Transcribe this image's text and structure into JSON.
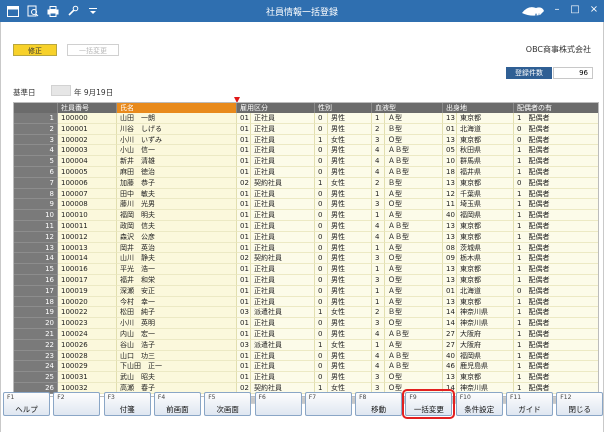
{
  "app": {
    "title": "社員情報一括登録",
    "company": "OBC商事株式会社"
  },
  "toolbar": {
    "icons": [
      "window-icon",
      "search-icon",
      "print-icon",
      "tools-icon",
      "dropdown-icon"
    ]
  },
  "mode": {
    "edit": "修正",
    "bulk": "一括変更"
  },
  "count": {
    "label": "登録件数",
    "value": "96"
  },
  "base_date": {
    "label": "基準日",
    "text": "年  9月19日"
  },
  "columns": [
    "社員番号",
    "氏名",
    "雇用区分",
    "",
    "性別",
    "",
    "血液型",
    "",
    "出身地",
    "",
    "配偶者の有"
  ],
  "rows": [
    {
      "n": "1",
      "id": "100000",
      "name": "山田　一朗",
      "ec": "01",
      "et": "正社員",
      "sc": "0",
      "st": "男性",
      "bc": "1",
      "bt": "Ａ型",
      "pc": "13",
      "pt": "東京都",
      "sp": "1　配偶者"
    },
    {
      "n": "2",
      "id": "100001",
      "name": "川谷　しげる",
      "ec": "01",
      "et": "正社員",
      "sc": "0",
      "st": "男性",
      "bc": "2",
      "bt": "Ｂ型",
      "pc": "01",
      "pt": "北海道",
      "sp": "0　配偶者"
    },
    {
      "n": "3",
      "id": "100002",
      "name": "小川　いずみ",
      "ec": "01",
      "et": "正社員",
      "sc": "1",
      "st": "女性",
      "bc": "3",
      "bt": "Ｏ型",
      "pc": "13",
      "pt": "東京都",
      "sp": "0　配偶者"
    },
    {
      "n": "4",
      "id": "100003",
      "name": "小山　信一",
      "ec": "01",
      "et": "正社員",
      "sc": "0",
      "st": "男性",
      "bc": "4",
      "bt": "ＡＢ型",
      "pc": "05",
      "pt": "秋田県",
      "sp": "1　配偶者"
    },
    {
      "n": "5",
      "id": "100004",
      "name": "新井　清雄",
      "ec": "01",
      "et": "正社員",
      "sc": "0",
      "st": "男性",
      "bc": "4",
      "bt": "ＡＢ型",
      "pc": "10",
      "pt": "群馬県",
      "sp": "1　配偶者"
    },
    {
      "n": "6",
      "id": "100005",
      "name": "麻田　徳治",
      "ec": "01",
      "et": "正社員",
      "sc": "0",
      "st": "男性",
      "bc": "4",
      "bt": "ＡＢ型",
      "pc": "18",
      "pt": "福井県",
      "sp": "1　配偶者"
    },
    {
      "n": "7",
      "id": "100006",
      "name": "加藤　恭子",
      "ec": "02",
      "et": "契約社員",
      "sc": "1",
      "st": "女性",
      "bc": "2",
      "bt": "Ｂ型",
      "pc": "13",
      "pt": "東京都",
      "sp": "0　配偶者"
    },
    {
      "n": "8",
      "id": "100007",
      "name": "田中　敏夫",
      "ec": "01",
      "et": "正社員",
      "sc": "0",
      "st": "男性",
      "bc": "1",
      "bt": "Ａ型",
      "pc": "12",
      "pt": "千葉県",
      "sp": "1　配偶者"
    },
    {
      "n": "9",
      "id": "100008",
      "name": "藤川　光男",
      "ec": "01",
      "et": "正社員",
      "sc": "0",
      "st": "男性",
      "bc": "3",
      "bt": "Ｏ型",
      "pc": "11",
      "pt": "埼玉県",
      "sp": "1　配偶者"
    },
    {
      "n": "10",
      "id": "100010",
      "name": "福岡　明夫",
      "ec": "01",
      "et": "正社員",
      "sc": "0",
      "st": "男性",
      "bc": "1",
      "bt": "Ａ型",
      "pc": "40",
      "pt": "福岡県",
      "sp": "1　配偶者"
    },
    {
      "n": "11",
      "id": "100011",
      "name": "政岡　信夫",
      "ec": "01",
      "et": "正社員",
      "sc": "0",
      "st": "男性",
      "bc": "4",
      "bt": "ＡＢ型",
      "pc": "13",
      "pt": "東京都",
      "sp": "1　配偶者"
    },
    {
      "n": "12",
      "id": "100012",
      "name": "森沢　公彦",
      "ec": "01",
      "et": "正社員",
      "sc": "0",
      "st": "男性",
      "bc": "4",
      "bt": "ＡＢ型",
      "pc": "13",
      "pt": "東京都",
      "sp": "1　配偶者"
    },
    {
      "n": "13",
      "id": "100013",
      "name": "岡井　英治",
      "ec": "01",
      "et": "正社員",
      "sc": "0",
      "st": "男性",
      "bc": "1",
      "bt": "Ａ型",
      "pc": "08",
      "pt": "茨城県",
      "sp": "1　配偶者"
    },
    {
      "n": "14",
      "id": "100014",
      "name": "山川　静夫",
      "ec": "02",
      "et": "契約社員",
      "sc": "0",
      "st": "男性",
      "bc": "3",
      "bt": "Ｏ型",
      "pc": "09",
      "pt": "栃木県",
      "sp": "1　配偶者"
    },
    {
      "n": "15",
      "id": "100016",
      "name": "平光　浩一",
      "ec": "01",
      "et": "正社員",
      "sc": "0",
      "st": "男性",
      "bc": "1",
      "bt": "Ａ型",
      "pc": "13",
      "pt": "東京都",
      "sp": "1　配偶者"
    },
    {
      "n": "16",
      "id": "100017",
      "name": "福井　和栄",
      "ec": "01",
      "et": "正社員",
      "sc": "0",
      "st": "男性",
      "bc": "3",
      "bt": "Ｏ型",
      "pc": "13",
      "pt": "東京都",
      "sp": "1　配偶者"
    },
    {
      "n": "17",
      "id": "100019",
      "name": "深瀬　安正",
      "ec": "01",
      "et": "正社員",
      "sc": "0",
      "st": "男性",
      "bc": "1",
      "bt": "Ａ型",
      "pc": "01",
      "pt": "北海道",
      "sp": "0　配偶者"
    },
    {
      "n": "18",
      "id": "100020",
      "name": "今村　幸一",
      "ec": "01",
      "et": "正社員",
      "sc": "0",
      "st": "男性",
      "bc": "1",
      "bt": "Ａ型",
      "pc": "13",
      "pt": "東京都",
      "sp": "1　配偶者"
    },
    {
      "n": "19",
      "id": "100022",
      "name": "松田　純子",
      "ec": "03",
      "et": "派遣社員",
      "sc": "1",
      "st": "女性",
      "bc": "2",
      "bt": "Ｂ型",
      "pc": "14",
      "pt": "神奈川県",
      "sp": "1　配偶者"
    },
    {
      "n": "20",
      "id": "100023",
      "name": "小川　英明",
      "ec": "01",
      "et": "正社員",
      "sc": "0",
      "st": "男性",
      "bc": "3",
      "bt": "Ｏ型",
      "pc": "14",
      "pt": "神奈川県",
      "sp": "1　配偶者"
    },
    {
      "n": "21",
      "id": "100024",
      "name": "内山　宏一",
      "ec": "01",
      "et": "正社員",
      "sc": "0",
      "st": "男性",
      "bc": "4",
      "bt": "ＡＢ型",
      "pc": "27",
      "pt": "大阪府",
      "sp": "1　配偶者"
    },
    {
      "n": "22",
      "id": "100026",
      "name": "谷山　浩子",
      "ec": "03",
      "et": "派遣社員",
      "sc": "1",
      "st": "女性",
      "bc": "1",
      "bt": "Ａ型",
      "pc": "27",
      "pt": "大阪府",
      "sp": "1　配偶者"
    },
    {
      "n": "23",
      "id": "100028",
      "name": "山口　功三",
      "ec": "01",
      "et": "正社員",
      "sc": "0",
      "st": "男性",
      "bc": "4",
      "bt": "ＡＢ型",
      "pc": "40",
      "pt": "福岡県",
      "sp": "1　配偶者"
    },
    {
      "n": "24",
      "id": "100029",
      "name": "下山田　正一",
      "ec": "01",
      "et": "正社員",
      "sc": "0",
      "st": "男性",
      "bc": "4",
      "bt": "ＡＢ型",
      "pc": "46",
      "pt": "鹿児島県",
      "sp": "1　配偶者"
    },
    {
      "n": "25",
      "id": "100031",
      "name": "武山　昭夫",
      "ec": "01",
      "et": "正社員",
      "sc": "0",
      "st": "男性",
      "bc": "3",
      "bt": "Ｏ型",
      "pc": "13",
      "pt": "東京都",
      "sp": "1　配偶者"
    },
    {
      "n": "26",
      "id": "100032",
      "name": "高瀬　春子",
      "ec": "02",
      "et": "契約社員",
      "sc": "1",
      "st": "女性",
      "bc": "3",
      "bt": "Ｏ型",
      "pc": "14",
      "pt": "神奈川県",
      "sp": "1　配偶者"
    }
  ],
  "fkeys": [
    {
      "key": "F1",
      "label": "ヘルプ"
    },
    {
      "key": "F2",
      "label": ""
    },
    {
      "key": "F3",
      "label": "付箋"
    },
    {
      "key": "F4",
      "label": "前画面"
    },
    {
      "key": "F5",
      "label": "次画面"
    },
    {
      "key": "F6",
      "label": ""
    },
    {
      "key": "F7",
      "label": ""
    },
    {
      "key": "F8",
      "label": "移動"
    },
    {
      "key": "F9",
      "label": "一括変更"
    },
    {
      "key": "F10",
      "label": "条件設定"
    },
    {
      "key": "F11",
      "label": "ガイド"
    },
    {
      "key": "F12",
      "label": "閉じる"
    }
  ],
  "colors": {
    "titlebar": "#2f6fb0",
    "header": "#6b6b6b",
    "selected_header": "#e88a1c",
    "mode_edit": "#f7d12a",
    "highlight": "#e22020"
  }
}
